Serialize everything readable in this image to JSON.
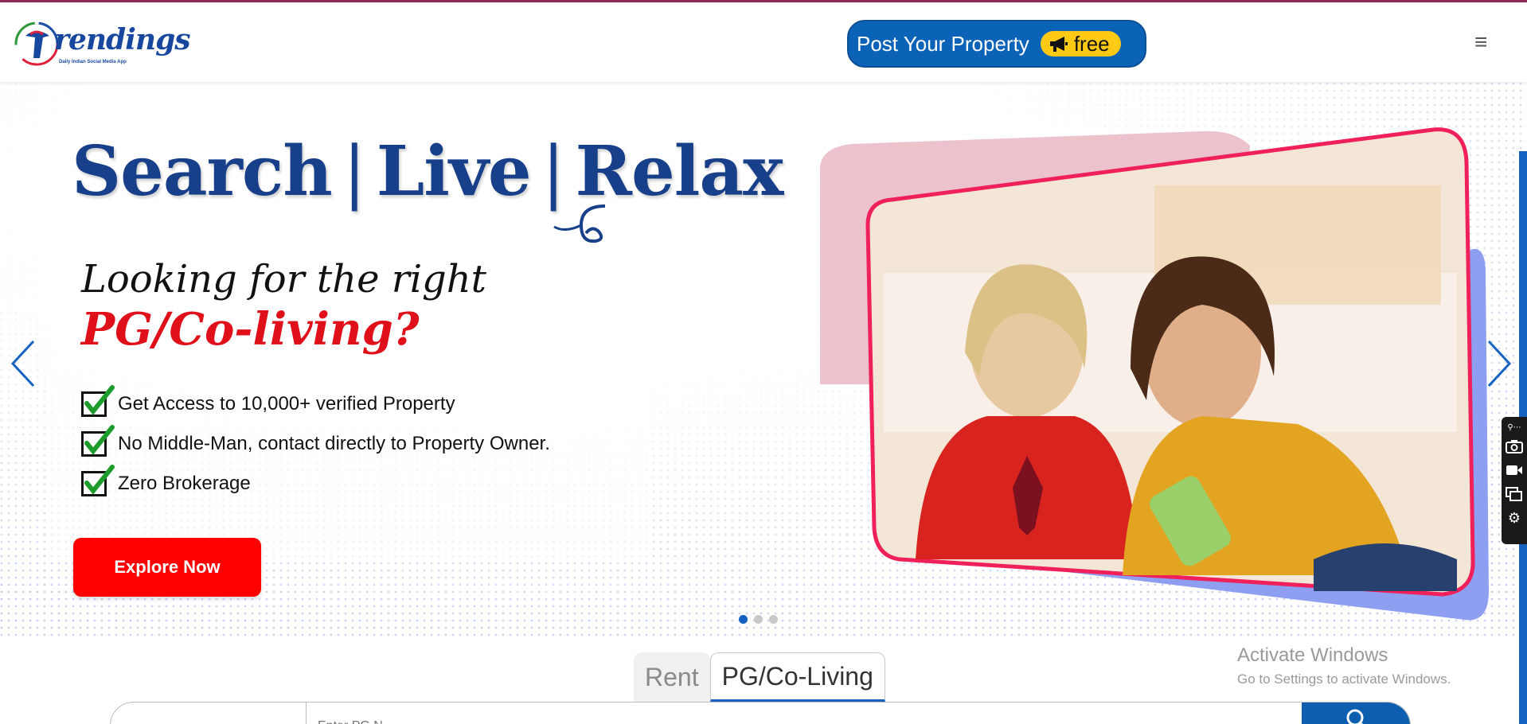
{
  "header": {
    "logo_text": "rendings",
    "logo_tagline": "Daily Indian Social Media App",
    "post_button_label": "Post Your Property",
    "post_button_badge": "free",
    "menu_icon": "≡"
  },
  "hero": {
    "headline_1": "Search",
    "headline_2": "Live",
    "headline_3": "Relax",
    "subheading": "Looking for the right",
    "highlight": "PG/Co-living?",
    "features": [
      "Get Access to 10,000+ verified Property",
      "No Middle-Man, contact directly to Property Owner.",
      "Zero Brokerage"
    ],
    "cta_label": "Explore Now",
    "slides": 3,
    "active_slide": 1
  },
  "search": {
    "tabs": [
      "Rent",
      "PG/Co-Living"
    ],
    "active_tab": "PG/Co-Living",
    "city_value": "",
    "input_placeholder": "Enter PG N..."
  },
  "overlay": {
    "watermark_title": "Activate Windows",
    "watermark_sub": "Go to Settings to activate Windows."
  },
  "colors": {
    "brand_blue": "#0b63b8",
    "accent_red": "#ff0000",
    "badge_yellow": "#ffc914",
    "headline_navy": "#173f8a"
  }
}
